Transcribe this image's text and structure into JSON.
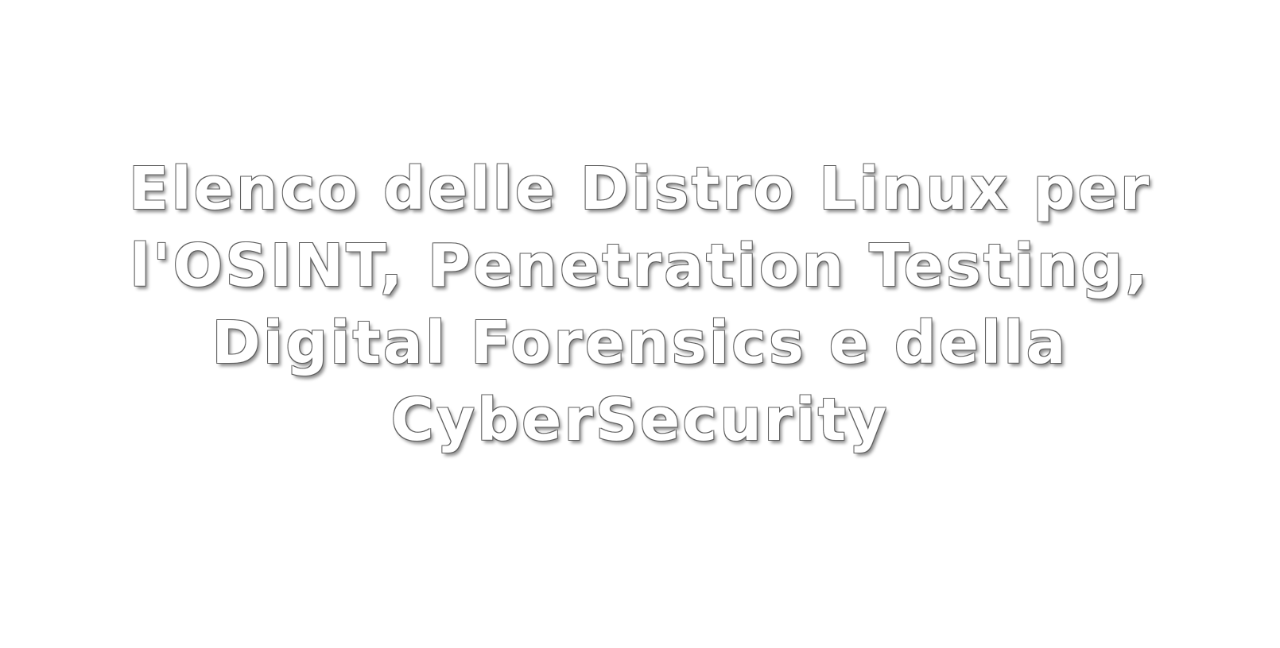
{
  "title": {
    "lines": [
      "Elenco delle Distro Linux per",
      "l'OSINT, Penetration Testing,",
      "Digital Forensics e della",
      "CyberSecurity"
    ]
  },
  "colors": {
    "background": "#ffffff",
    "text": "#ffffff",
    "outline": "#5e5e5e"
  }
}
